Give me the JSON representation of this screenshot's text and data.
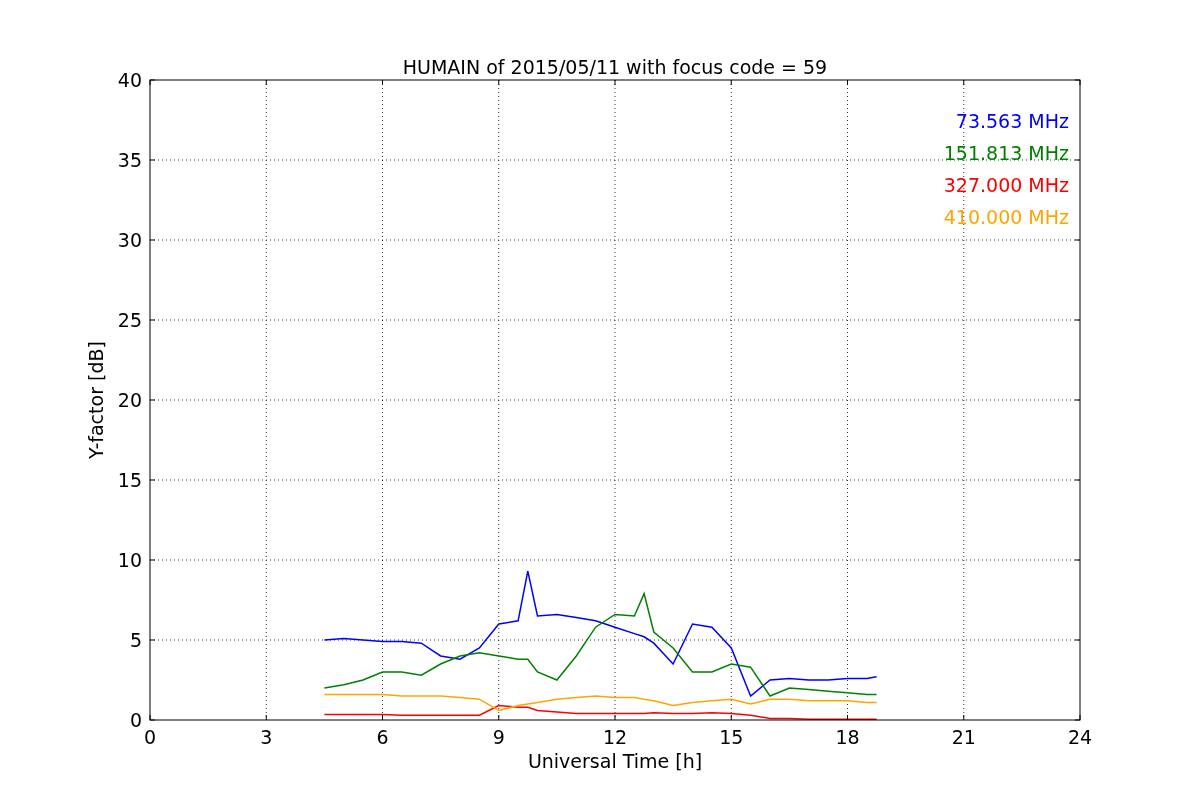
{
  "figure": {
    "chart_data": {
      "type": "line",
      "title": "HUMAIN of 2015/05/11 with focus code = 59",
      "xlabel": "Universal Time [h]",
      "ylabel": "Y-factor [dB]",
      "x": [
        4.5,
        5,
        5.5,
        6,
        6.5,
        7,
        7.5,
        8,
        8.5,
        9,
        9.5,
        9.75,
        10,
        10.5,
        11,
        11.5,
        12,
        12.5,
        12.75,
        13,
        13.5,
        14,
        14.5,
        15,
        15.5,
        16,
        16.5,
        17,
        17.5,
        18,
        18.5,
        18.75
      ],
      "series": [
        {
          "name": "73.563 MHz",
          "color": "#0000ff",
          "values": [
            5.0,
            5.1,
            5.0,
            4.9,
            4.9,
            4.8,
            4.0,
            3.8,
            4.5,
            6.0,
            6.2,
            9.3,
            6.5,
            6.6,
            6.4,
            6.2,
            5.8,
            5.4,
            5.2,
            4.8,
            3.5,
            6.0,
            5.8,
            4.5,
            1.5,
            2.5,
            2.6,
            2.5,
            2.5,
            2.6,
            2.6,
            2.7
          ]
        },
        {
          "name": "151.813 MHz",
          "color": "#008000",
          "values": [
            2.0,
            2.2,
            2.5,
            3.0,
            3.0,
            2.8,
            3.5,
            4.0,
            4.2,
            4.0,
            3.8,
            3.8,
            3.0,
            2.5,
            4.0,
            5.8,
            6.6,
            6.5,
            7.9,
            5.5,
            4.5,
            3.0,
            3.0,
            3.5,
            3.3,
            1.5,
            2.0,
            1.9,
            1.8,
            1.7,
            1.6,
            1.6
          ]
        },
        {
          "name": "327.000 MHz",
          "color": "#ff0000",
          "values": [
            0.35,
            0.35,
            0.35,
            0.35,
            0.3,
            0.3,
            0.3,
            0.3,
            0.3,
            0.9,
            0.8,
            0.8,
            0.6,
            0.5,
            0.4,
            0.4,
            0.4,
            0.4,
            0.4,
            0.45,
            0.4,
            0.4,
            0.45,
            0.4,
            0.3,
            0.1,
            0.1,
            0.05,
            0.05,
            0.05,
            0.05,
            0.05
          ]
        },
        {
          "name": "410.000 MHz",
          "color": "#ffa500",
          "values": [
            1.6,
            1.6,
            1.6,
            1.6,
            1.5,
            1.5,
            1.5,
            1.4,
            1.3,
            0.6,
            0.9,
            1.0,
            1.1,
            1.3,
            1.4,
            1.5,
            1.4,
            1.4,
            1.3,
            1.2,
            0.9,
            1.1,
            1.2,
            1.3,
            1.0,
            1.3,
            1.3,
            1.2,
            1.2,
            1.2,
            1.1,
            1.1
          ]
        }
      ],
      "xlim": [
        0,
        24
      ],
      "ylim": [
        0,
        40
      ],
      "grid": true,
      "xticks": [
        0,
        3,
        6,
        9,
        12,
        15,
        18,
        21,
        24
      ],
      "yticks": [
        0,
        5,
        10,
        15,
        20,
        25,
        30,
        35,
        40
      ]
    }
  }
}
